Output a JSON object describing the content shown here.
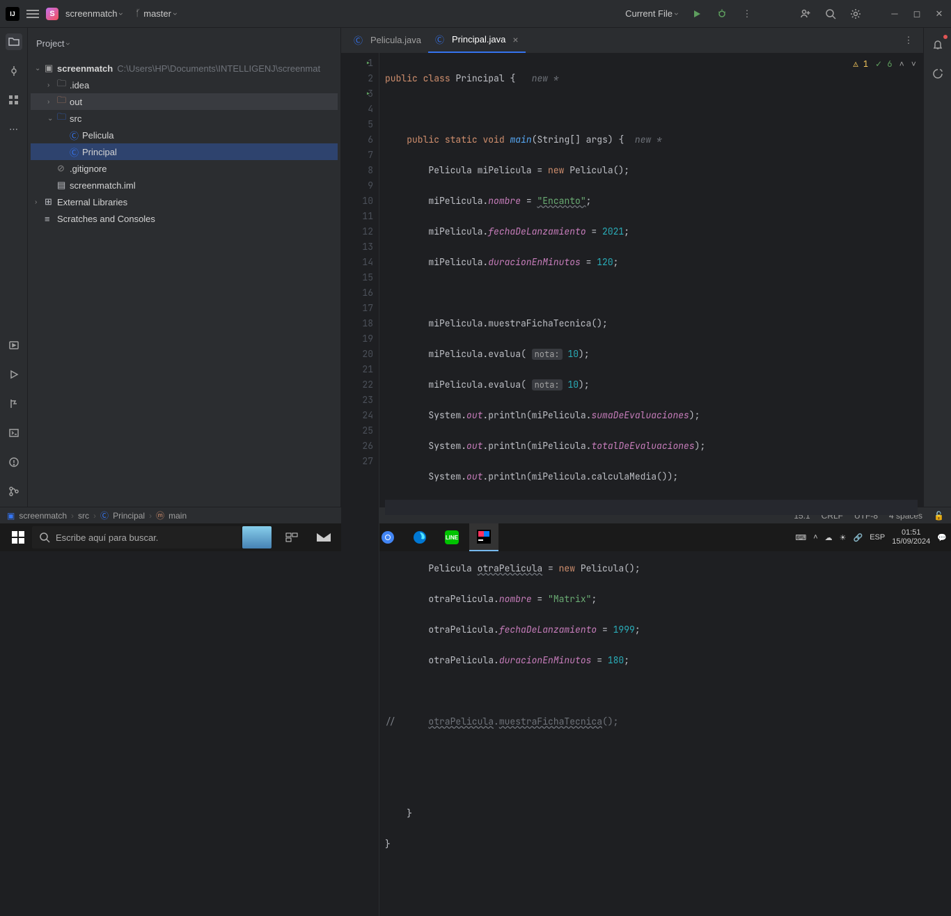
{
  "titlebar": {
    "project_name": "screenmatch",
    "branch": "master",
    "run_config": "Current File"
  },
  "project_panel": {
    "title": "Project",
    "root": "screenmatch",
    "root_path": "C:\\Users\\HP\\Documents\\INTELLIGENJ\\screenmat",
    "idea": ".idea",
    "out": "out",
    "src": "src",
    "pelicula": "Pelicula",
    "principal": "Principal",
    "gitignore": ".gitignore",
    "iml": "screenmatch.iml",
    "external": "External Libraries",
    "scratches": "Scratches and Consoles"
  },
  "tabs": [
    {
      "label": "Pelicula.java"
    },
    {
      "label": "Principal.java"
    }
  ],
  "editor": {
    "warn_count": "1",
    "check_count": "6",
    "new_hint": "new *",
    "nota_hint": "nota:"
  },
  "code": {
    "l1_kw1": "public",
    "l1_kw2": "class",
    "l1_name": "Principal",
    "l1_brace": "{",
    "l3_kw1": "public",
    "l3_kw2": "static",
    "l3_kw3": "void",
    "l3_name": "main",
    "l3_args": "(String[] args) {",
    "l4_a": "Pelicula miPelicula = ",
    "l4_new": "new",
    "l4_b": " Pelicula();",
    "l5_a": "miPelicula.",
    "l5_f": "nombre",
    "l5_b": " = ",
    "l5_s": "\"Encanto\"",
    "l5_c": ";",
    "l6_a": "miPelicula.",
    "l6_f": "fechaDeLanzamiento",
    "l6_b": " = ",
    "l6_n": "2021",
    "l6_c": ";",
    "l7_a": "miPelicula.",
    "l7_f": "duracionEnMinutos",
    "l7_b": " = ",
    "l7_n": "120",
    "l7_c": ";",
    "l9_a": "miPelicula.muestraFichaTecnica();",
    "l10_a": "miPelicula.evalua( ",
    "l10_n": "10",
    "l10_b": ");",
    "l11_a": "miPelicula.evalua( ",
    "l11_n": "10",
    "l11_b": ");",
    "l12_a": "System.",
    "l12_out": "out",
    "l12_b": ".println(miPelicula.",
    "l12_f": "sumaDeEvaluaciones",
    "l12_c": ");",
    "l13_a": "System.",
    "l13_out": "out",
    "l13_b": ".println(miPelicula.",
    "l13_f": "totalDeEvaluaciones",
    "l13_c": ");",
    "l14_a": "System.",
    "l14_out": "out",
    "l14_b": ".println(miPelicula.calculaMedia());",
    "l17_a": "Pelicula ",
    "l17_u": "otraPelicula",
    "l17_b": " = ",
    "l17_new": "new",
    "l17_c": " Pelicula();",
    "l18_a": "otraPelicula.",
    "l18_f": "nombre",
    "l18_b": " = ",
    "l18_s": "\"Matrix\"",
    "l18_c": ";",
    "l19_a": "otraPelicula.",
    "l19_f": "fechaDeLanzamiento",
    "l19_b": " = ",
    "l19_n": "1999",
    "l19_c": ";",
    "l20_a": "otraPelicula.",
    "l20_f": "duracionEnMinutos",
    "l20_b": " = ",
    "l20_n": "180",
    "l20_c": ";",
    "l22_a": "//      ",
    "l22_u1": "otraPelicula",
    "l22_dot": ".",
    "l22_u2": "muestraFichaTecnica",
    "l22_b": "();",
    "l25_a": "}",
    "l26_a": "}"
  },
  "statusbar": {
    "crumb1": "screenmatch",
    "crumb2": "src",
    "crumb3": "Principal",
    "crumb4": "main",
    "pos": "15:1",
    "lineend": "CRLF",
    "encoding": "UTF-8",
    "indent": "4 spaces"
  },
  "taskbar": {
    "search_placeholder": "Escribe aquí para buscar.",
    "lang": "ESP",
    "time": "01:51",
    "date": "15/09/2024"
  }
}
